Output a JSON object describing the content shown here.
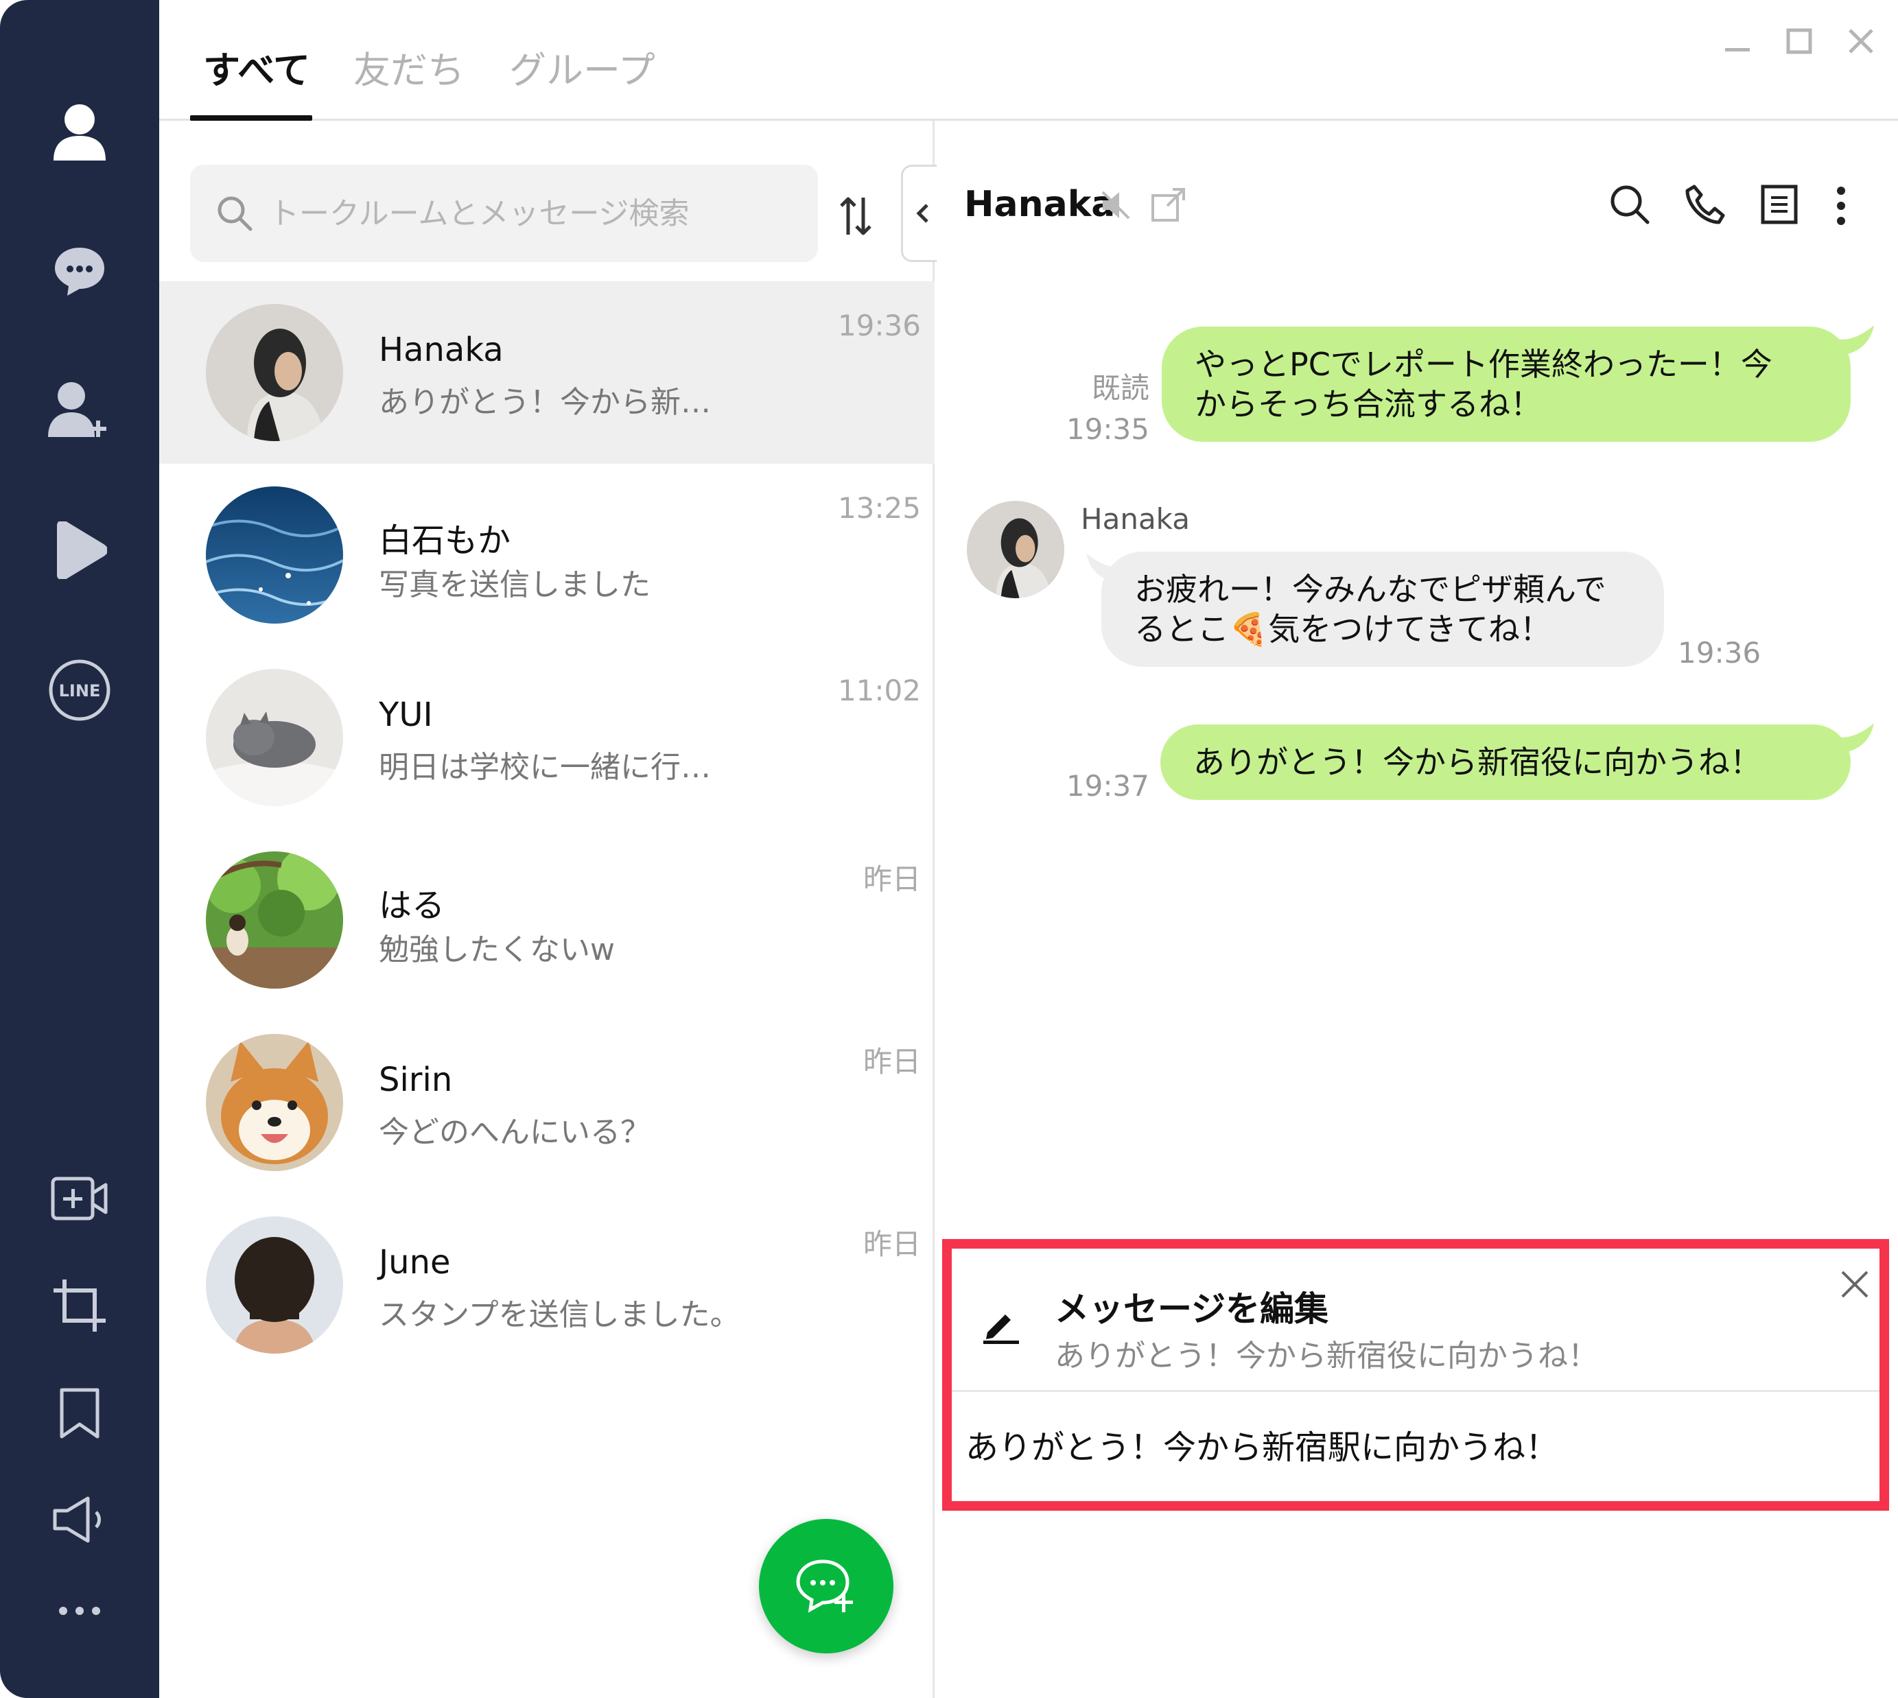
{
  "tabs": [
    {
      "label": "すべて"
    },
    {
      "label": "友だち"
    },
    {
      "label": "グループ"
    }
  ],
  "search": {
    "placeholder": "トークルームとメッセージ検索"
  },
  "chats": [
    {
      "name": "Hanaka",
      "preview": "ありがとう！今から新…",
      "time": "19:36"
    },
    {
      "name": "白石もか",
      "preview": "写真を送信しました",
      "time": "13:25"
    },
    {
      "name": "YUI",
      "preview": "明日は学校に一緒に行…",
      "time": "11:02"
    },
    {
      "name": "はる",
      "preview": "勉強したくないw",
      "time": "昨日"
    },
    {
      "name": "Sirin",
      "preview": "今どのへんにいる？",
      "time": "昨日"
    },
    {
      "name": "June",
      "preview": "スタンプを送信しました。",
      "time": "昨日"
    }
  ],
  "chat": {
    "name": "Hanaka",
    "messages": [
      {
        "from": "me",
        "line1": "やっとPCでレポート作業終わったー！今",
        "line2": "からそっち合流するね！",
        "read": "既読",
        "time": "19:35"
      },
      {
        "from": "Hanaka",
        "sender": "Hanaka",
        "line1": "お疲れー！今みんなでピザ頼んで",
        "line2": "るとこ🍕気をつけてきてね！",
        "time": "19:36"
      },
      {
        "from": "me",
        "line1": "ありがとう！今から新宿役に向かうね！",
        "time": "19:37"
      }
    ]
  },
  "edit": {
    "title": "メッセージを編集",
    "original": "ありがとう！今から新宿役に向かうね！",
    "value": "ありがとう！今から新宿駅に向かうね！"
  },
  "colors": {
    "sidebar": "#1f2944",
    "bubble_me": "#c4f18e",
    "bubble_you": "#eeeeee",
    "fab": "#06b93e",
    "highlight": "#f5334d"
  },
  "icons": {
    "sidebar": [
      "person-icon",
      "chat-bubble-icon",
      "add-friend-icon",
      "play-icon",
      "line-logo-icon",
      "video-add-icon",
      "crop-icon",
      "bookmark-icon",
      "speaker-icon",
      "more-icon"
    ],
    "header": [
      "mute-icon",
      "popout-icon",
      "search-icon",
      "phone-icon",
      "notes-icon",
      "kebab-icon"
    ]
  }
}
